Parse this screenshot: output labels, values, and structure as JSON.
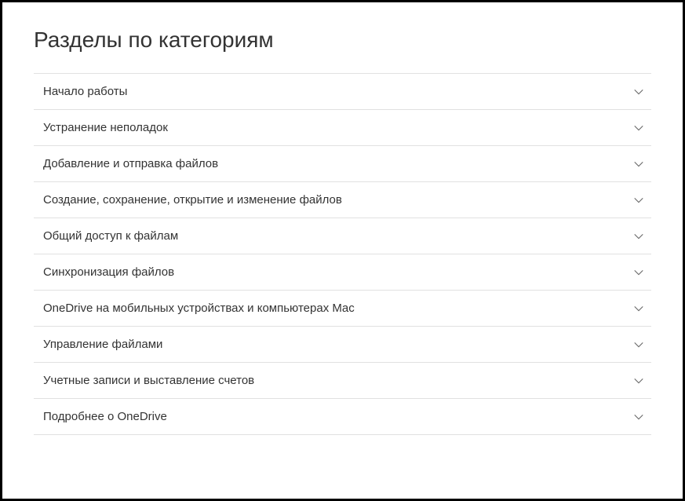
{
  "heading": "Разделы по категориям",
  "categories": [
    {
      "label": "Начало работы"
    },
    {
      "label": "Устранение неполадок"
    },
    {
      "label": "Добавление и отправка файлов"
    },
    {
      "label": "Создание, сохранение, открытие и изменение файлов"
    },
    {
      "label": "Общий доступ к файлам"
    },
    {
      "label": "Синхронизация файлов"
    },
    {
      "label": "OneDrive на мобильных устройствах и компьютерах Mac"
    },
    {
      "label": "Управление файлами"
    },
    {
      "label": "Учетные записи и выставление счетов"
    },
    {
      "label": "Подробнее о OneDrive"
    }
  ]
}
